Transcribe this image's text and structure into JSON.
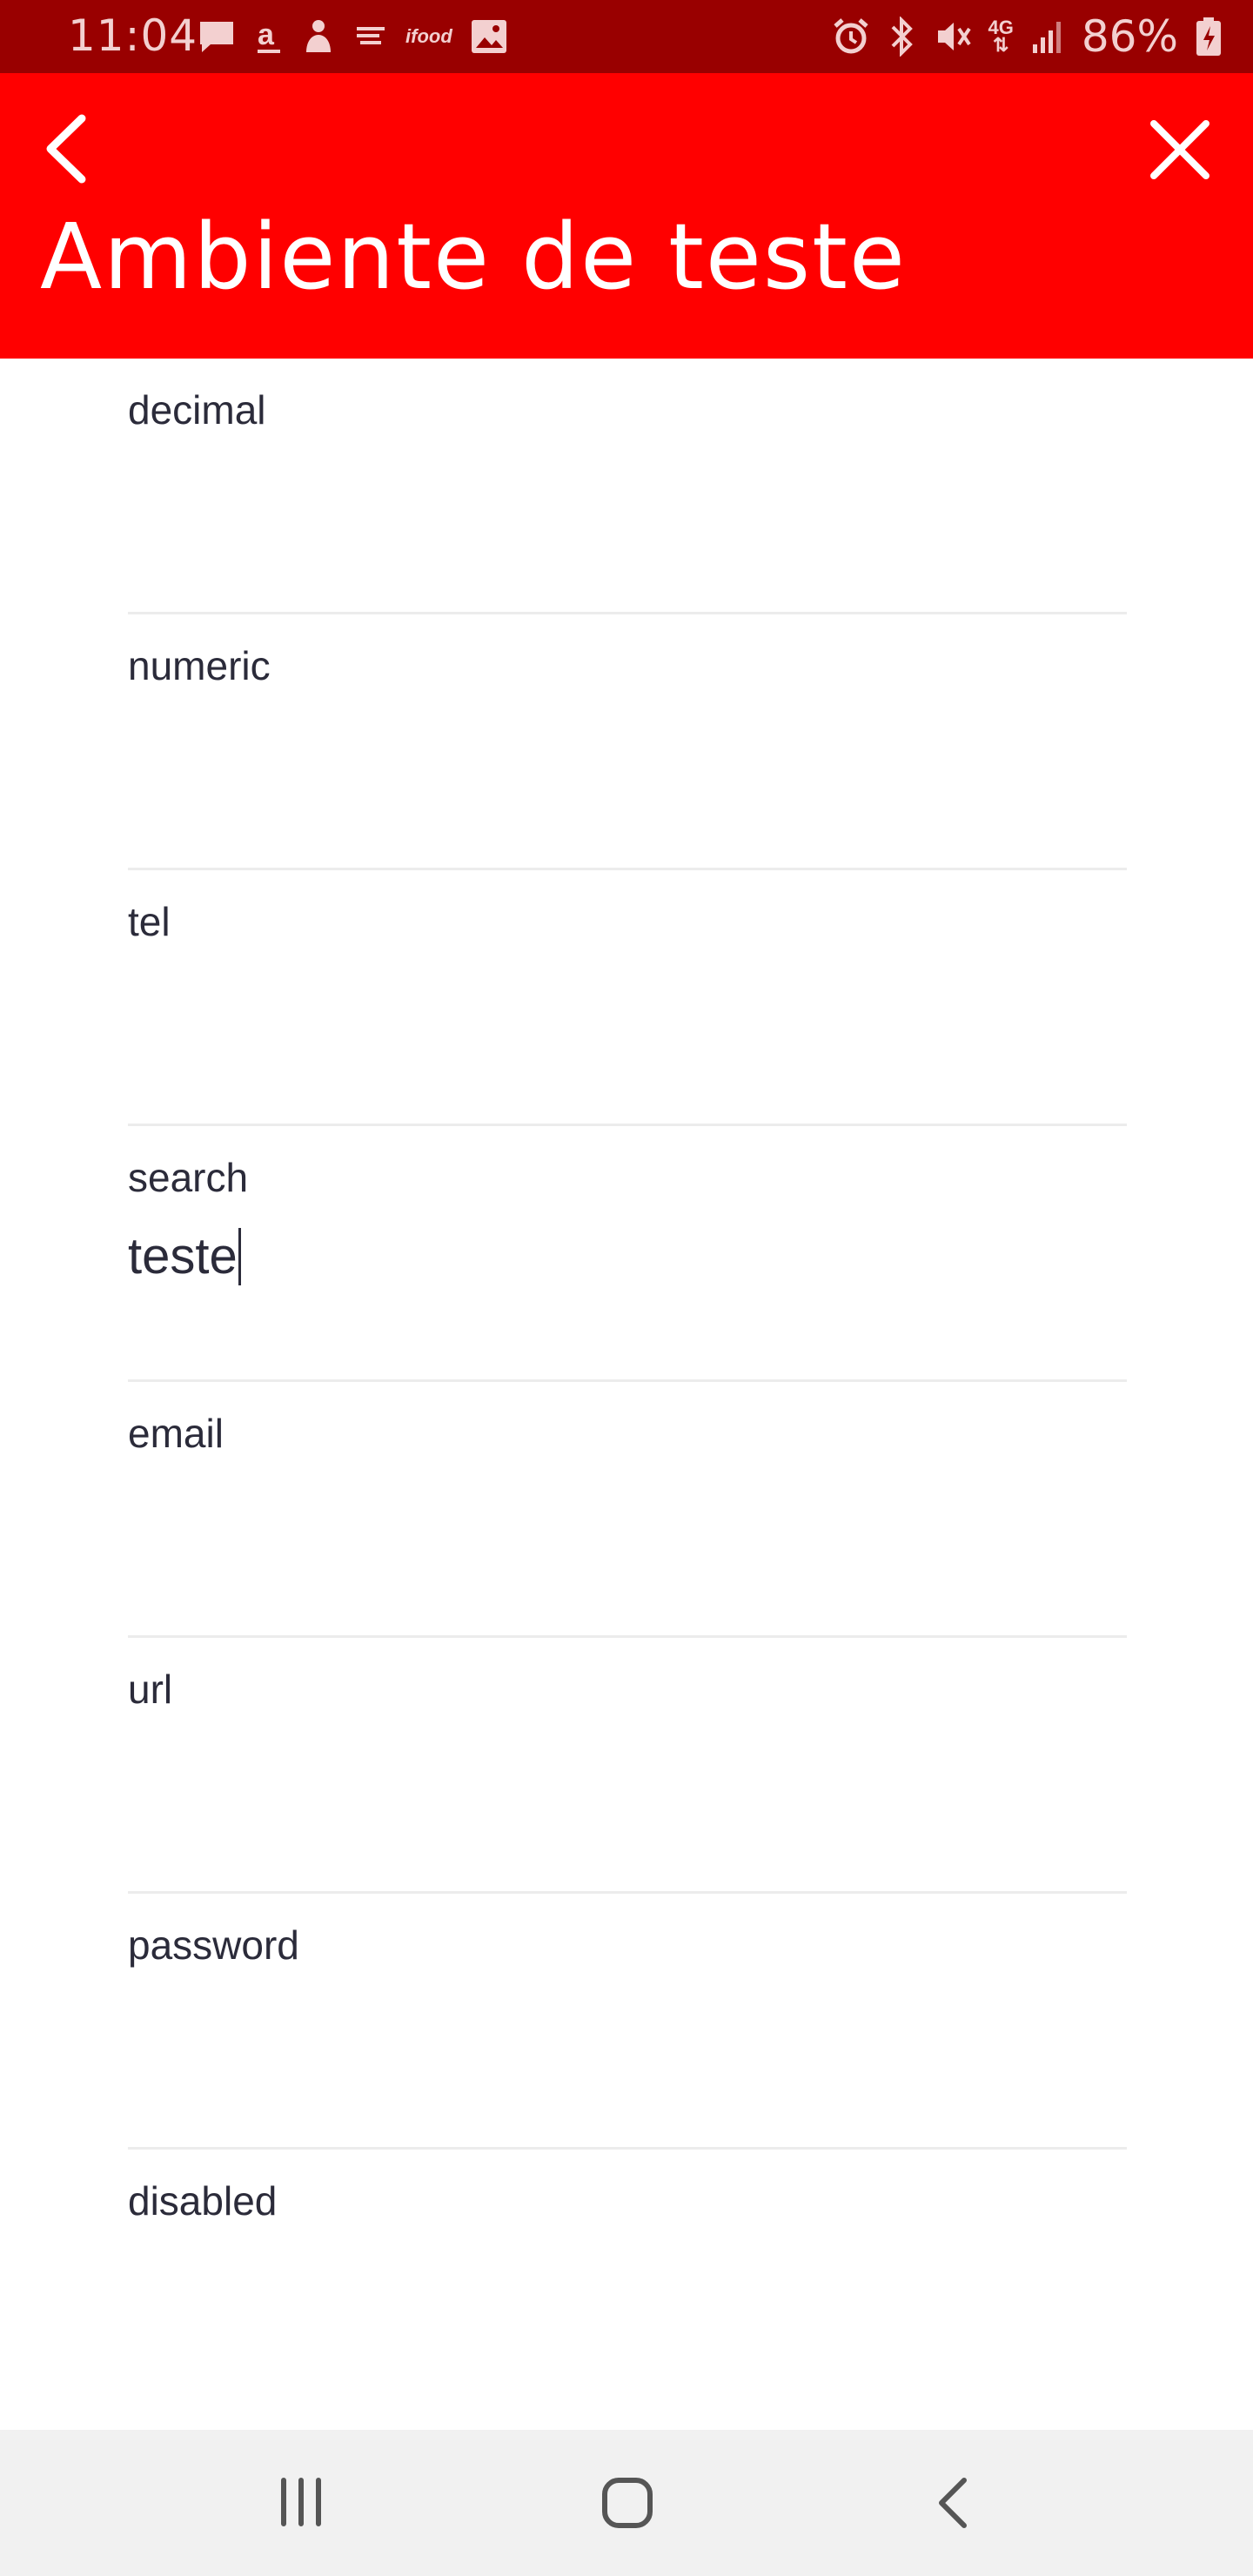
{
  "status_bar": {
    "time": "11:04",
    "battery_percent": "86%",
    "network_label": "4G",
    "app_label": "ifood",
    "left_icons": [
      "message-icon",
      "amazon-icon",
      "notification-icon",
      "cast-icon",
      "ifood-icon",
      "gallery-icon"
    ],
    "right_icons": [
      "alarm-icon",
      "bluetooth-icon",
      "mute-icon",
      "network-4g-icon",
      "signal-icon",
      "battery-charging-icon"
    ]
  },
  "header": {
    "title": "Ambiente de teste",
    "back_icon": "chevron-left-icon",
    "close_icon": "close-icon",
    "color": "#ff0000"
  },
  "form": {
    "fields": [
      {
        "label": "decimal",
        "value": ""
      },
      {
        "label": "numeric",
        "value": ""
      },
      {
        "label": "tel",
        "value": ""
      },
      {
        "label": "search",
        "value": "teste"
      },
      {
        "label": "email",
        "value": ""
      },
      {
        "label": "url",
        "value": ""
      },
      {
        "label": "password",
        "value": ""
      },
      {
        "label": "disabled",
        "value": ""
      }
    ]
  },
  "nav_bar": {
    "icons": [
      "recent-apps-icon",
      "home-icon",
      "back-icon"
    ]
  },
  "colors": {
    "status_bar": "#990000",
    "header": "#ff0000",
    "text": "#2b2b3a",
    "divider": "#ececec",
    "nav_bar": "#f1f1f1"
  }
}
